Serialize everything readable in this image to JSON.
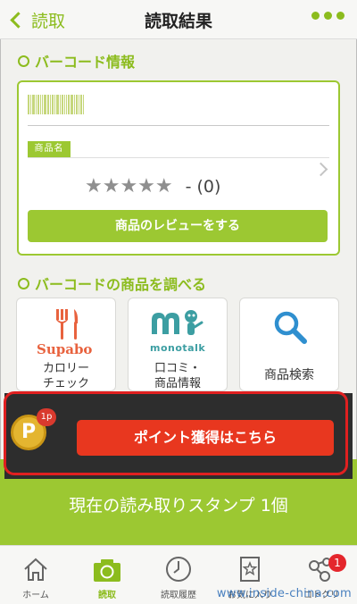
{
  "header": {
    "back_label": "読取",
    "title": "読取結果"
  },
  "barcode_section": {
    "heading": "バーコード情報",
    "name_tag": "商品名",
    "stars": "★★★★★",
    "rating_count": "- (0)",
    "rating_stars": 0,
    "review_button": "商品のレビューをする"
  },
  "services_section": {
    "heading": "バーコードの商品を調べる",
    "tiles": [
      {
        "logo": "Supabo",
        "label_line1": "カロリー",
        "label_line2": "チェック"
      },
      {
        "logo": "monotalk",
        "label_line1": "口コミ・",
        "label_line2": "商品情報"
      },
      {
        "label_line1": "商品検索"
      }
    ]
  },
  "points": {
    "coin_letter": "P",
    "coin_badge": "1p",
    "button": "ポイント獲得はこちら"
  },
  "stamp": {
    "text": "現在の読み取りスタンプ 1個"
  },
  "tabbar": {
    "tabs": [
      {
        "label": "ホーム"
      },
      {
        "label": "読取"
      },
      {
        "label": "読取履歴"
      },
      {
        "label": "お気に入り"
      },
      {
        "label": "コトクリ",
        "badge": "1"
      }
    ]
  },
  "watermark": "www.inside-china.com",
  "colors": {
    "accent": "#9cc832",
    "point_red": "#e8371f",
    "banner_dark": "#2d2d2d"
  }
}
